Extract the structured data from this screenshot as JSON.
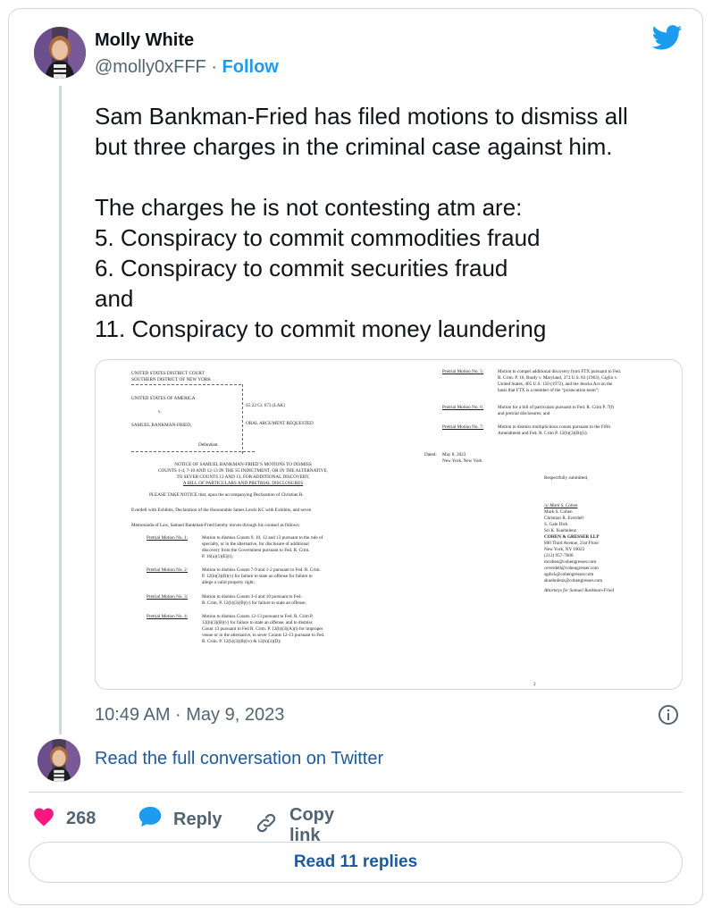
{
  "author": {
    "name": "Molly White",
    "handle": "@molly0xFFF",
    "separator": "·",
    "follow_label": "Follow"
  },
  "tweet": {
    "text": "Sam Bankman-Fried has filed motions to dismiss all\nbut three charges in the criminal case against him.\n\nThe charges he is not contesting atm are:\n5. Conspiracy to commit commodities fraud\n6. Conspiracy to commit securities fraud\nand\n11. Conspiracy to commit money laundering",
    "timestamp": "10:49 AM · May 9, 2023"
  },
  "document": {
    "court": [
      "UNITED STATES DISTRICT COURT",
      "SOUTHERN DISTRICT OF NEW YORK"
    ],
    "plaintiff": "UNITED STATES OF AMERICA",
    "v": "v.",
    "defendant_name": "SAMUEL BANKMAN-FRIED,",
    "defendant_label": "Defendant.",
    "case_no": "S5 22 Cr. 673 (LAK)",
    "oral_argument": "ORAL ARGUMENT REQUESTED",
    "title": [
      "NOTICE OF SAMUEL BANKMAN-FRIED’S MOTIONS TO DISMISS",
      "COUNTS 1-4, 7-10 AND 12-13 IN THE S5 INDICTMENT, OR IN THE ALTERNATIVE,",
      "TO SEVER COUNTS 12 AND 13, FOR ADDITIONAL DISCOVERY,",
      "A BILL OF PARTICULARS AND PRETRIAL DISCLOSURES"
    ],
    "intro": [
      "PLEASE TAKE NOTICE that, upon the accompanying Declaration of Christian R.",
      "Everdell with Exhibits, Declaration of the Honourable James Lewis KC with Exhibits, and seven",
      "Memoranda of Law, Samuel Bankman-Fried hereby moves through his counsel as follows:"
    ],
    "motions_left": [
      {
        "label": "Pretrial Motion No. 1:",
        "lines": [
          "Motion to dismiss Counts 9, 10, 12 and 13 pursuant to the rule of",
          "specialty, or in the alternative, for disclosure of additional",
          "discovery from the Government pursuant to Fed. R. Crim.",
          "P. 16(a)(1)(E)(i);"
        ]
      },
      {
        "label": "Pretrial Motion No. 2:",
        "lines": [
          "Motion to dismiss Counts 7-9 and 1-2 pursuant to Fed. R. Crim.",
          "P. 12(b)(3)(B)(v) for failure to state an offense for failure to",
          "allege a valid property right;"
        ]
      },
      {
        "label": "Pretrial Motion No. 3:",
        "lines": [
          "Motion to dismiss Counts 3-4 and 10 pursuant to Fed.",
          "R. Crim. P. 12(b)(3)(B)(v) for failure to state an offense;"
        ]
      },
      {
        "label": "Pretrial Motion No. 4:",
        "lines": [
          "Motion to dismiss Counts 12-13 pursuant to Fed. R. Crim P.",
          "12(b)(3)(B)(v) for failure to state an offense, and to dismiss",
          "Count 13 pursuant to Fed R. Crim. P. 12(b)(3)(A)(i) for improper",
          "venue or in the alternative, to sever Counts 12-13 pursuant to Fed.",
          "R. Crim. P. 12(b)(3)(B)(iv) & 12(b)(3)(D);"
        ]
      }
    ],
    "motions_right": [
      {
        "label": "Pretrial Motion No. 5:",
        "lines": [
          "Motion to compel additional discovery from FTX pursuant to Fed.",
          "R. Crim. P. 16, Brady v. Maryland, 373 U.S. 83 (1963), Giglio v.",
          "United States, 405 U.S. 150 (1972), and the Jencks Act on the",
          "basis that FTX is a member of the “prosecution team”;"
        ]
      },
      {
        "label": "Pretrial Motion No. 6:",
        "lines": [
          "Motion for a bill of particulars pursuant to Fed. R. Crim P. 7(f)",
          "and pretrial disclosures; and"
        ]
      },
      {
        "label": "Pretrial Motion No. 7:",
        "lines": [
          "Motion to dismiss multiplicitous counts pursuant to the Fifth",
          "Amendment and Fed. R. Crim P. 12(b)(3)(B)(ii)."
        ]
      }
    ],
    "dated_label": "Dated:",
    "dated": [
      "May 8, 2023",
      "New York, New York"
    ],
    "respectfully": "Respectfully submitted,",
    "signature": [
      "/s/ Mark S. Cohen",
      "Mark S. Cohen",
      "Christian R. Everdell",
      "S. Gale Dick",
      "Sri K. Kuehnlenz"
    ],
    "firm": "COHEN & GRESSER LLP",
    "address": [
      "800 Third Avenue, 21st Floor",
      "New York, NY  10022",
      "(212) 957-7600",
      "mcohen@cohengresser.com",
      "ceverdell@cohengresser.com",
      "sgdick@cohengresser.com",
      "skuehnlenz@cohengresser.com"
    ],
    "attorneys_for": "Attorneys for Samuel Bankman-Fried",
    "page_number": "2"
  },
  "footer": {
    "read_conversation": "Read the full conversation on Twitter",
    "likes": "268",
    "reply_label": "Reply",
    "copy_link_label": "Copy link",
    "read_replies": "Read 11 replies"
  },
  "colors": {
    "link": "#1d5a9c",
    "twitter_blue": "#1d9bf0",
    "like_red": "#f91880",
    "muted": "#536471"
  },
  "icons": [
    "twitter-bird-icon",
    "info-icon",
    "heart-icon",
    "reply-bubble-icon",
    "link-icon"
  ]
}
